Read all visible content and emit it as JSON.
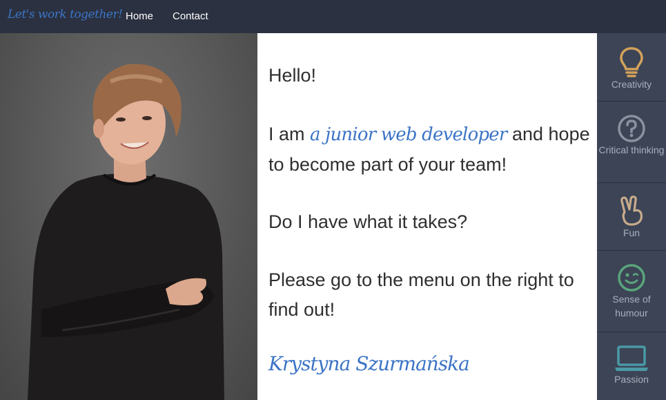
{
  "navbar": {
    "brand": "Let's work together!",
    "links": [
      "Home",
      "Contact"
    ]
  },
  "main": {
    "greeting": "Hello!",
    "intro_pre": "I am ",
    "intro_highlight": "a junior web developer",
    "intro_post": " and hope to become part of your team!",
    "question": "Do I have what it takes?",
    "cta": "Please go to the menu on the right to find out!",
    "signature": "Krystyna Szurmańska"
  },
  "sidebar": {
    "items": [
      {
        "label": "Creativity",
        "icon": "lightbulb-icon",
        "color": "#d4a25a"
      },
      {
        "label": "Critical thinking",
        "icon": "question-circle-icon",
        "color": "#8a929f"
      },
      {
        "label": "Fun",
        "icon": "peace-hand-icon",
        "color": "#c7ab8b"
      },
      {
        "label": "Sense of humour",
        "icon": "smile-icon",
        "color": "#5aa57c"
      },
      {
        "label": "Passion",
        "icon": "laptop-icon",
        "color": "#4a9aa6"
      }
    ]
  },
  "colors": {
    "navbar_bg": "#2b3140",
    "accent": "#3b74c6",
    "sidebar_bg": "#3c4456",
    "text": "#2f2f2f"
  }
}
